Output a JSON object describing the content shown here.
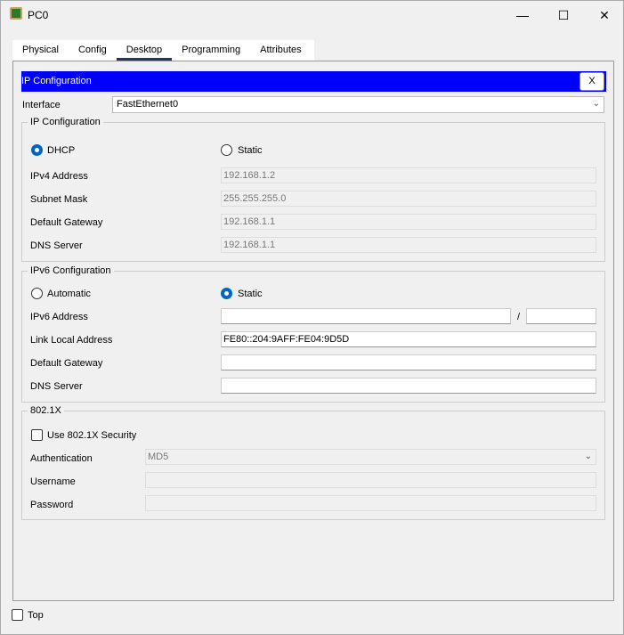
{
  "window": {
    "title": "PC0",
    "minimize": "—",
    "maximize": "☐",
    "close": "✕"
  },
  "tabs": [
    "Physical",
    "Config",
    "Desktop",
    "Programming",
    "Attributes"
  ],
  "header": {
    "title": "IP Configuration",
    "close_label": "X"
  },
  "interface": {
    "label": "Interface",
    "value": "FastEthernet0"
  },
  "ipv4": {
    "group_label": "IP Configuration",
    "dhcp": "DHCP",
    "static": "Static",
    "mode": "DHCP",
    "rows": [
      {
        "label": "IPv4 Address",
        "value": "192.168.1.2"
      },
      {
        "label": "Subnet Mask",
        "value": "255.255.255.0"
      },
      {
        "label": "Default Gateway",
        "value": "192.168.1.1"
      },
      {
        "label": "DNS Server",
        "value": "192.168.1.1"
      }
    ]
  },
  "ipv6": {
    "group_label": "IPv6 Configuration",
    "automatic": "Automatic",
    "static": "Static",
    "mode": "Static",
    "slash": "/",
    "address_label": "IPv6 Address",
    "address": "",
    "prefix": "",
    "link_local_label": "Link Local Address",
    "link_local": "FE80::204:9AFF:FE04:9D5D",
    "gateway_label": "Default Gateway",
    "gateway": "",
    "dns_label": "DNS Server",
    "dns": ""
  },
  "dot1x": {
    "group_label": "802.1X",
    "use_label": "Use 802.1X Security",
    "auth_label": "Authentication",
    "auth_value": "MD5",
    "username_label": "Username",
    "username": "",
    "password_label": "Password",
    "password": ""
  },
  "footer": {
    "top_label": "Top"
  }
}
